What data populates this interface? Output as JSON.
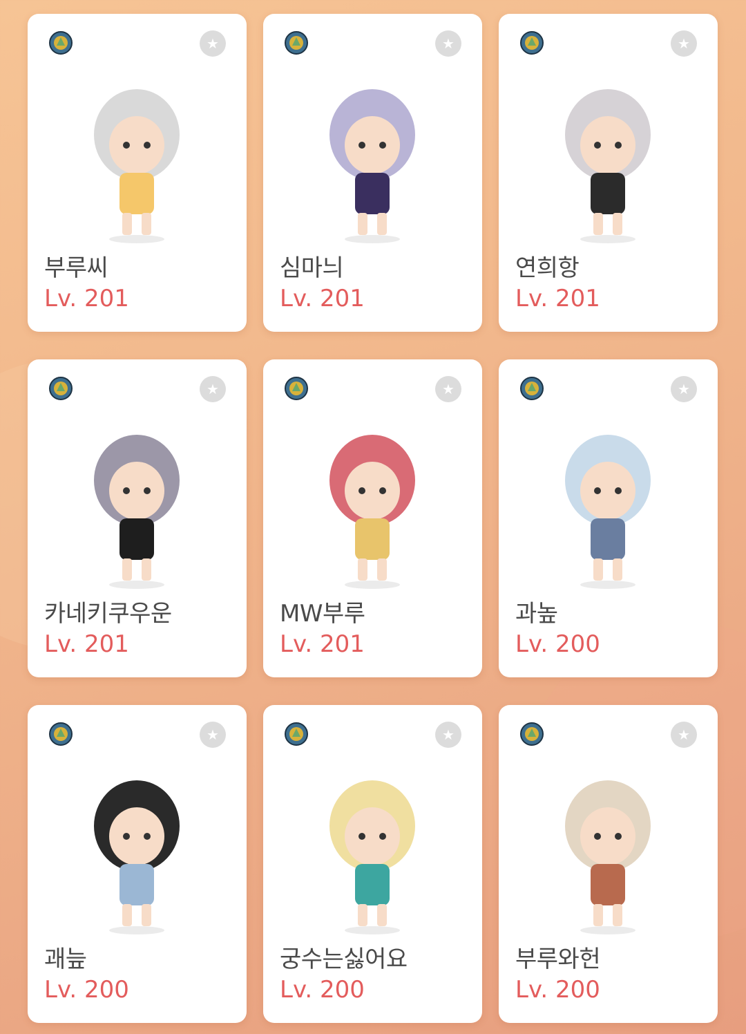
{
  "colors": {
    "level_text": "#e35c5c",
    "name_text": "#4a4a4a",
    "favorite_button": "#dcdcdc",
    "background": "#f2b98d"
  },
  "icons": {
    "world": "world-emblem-icon",
    "favorite": "star-icon"
  },
  "characters": [
    {
      "name": "부루씨",
      "level": "Lv. 201"
    },
    {
      "name": "심마늬",
      "level": "Lv. 201"
    },
    {
      "name": "연희항",
      "level": "Lv. 201"
    },
    {
      "name": "카네키쿠우운",
      "level": "Lv. 201"
    },
    {
      "name": "MW부루",
      "level": "Lv. 201"
    },
    {
      "name": "과높",
      "level": "Lv. 200"
    },
    {
      "name": "괘늪",
      "level": "Lv. 200"
    },
    {
      "name": "궁수는싫어요",
      "level": "Lv. 200"
    },
    {
      "name": "부루와헌",
      "level": "Lv. 200"
    }
  ]
}
